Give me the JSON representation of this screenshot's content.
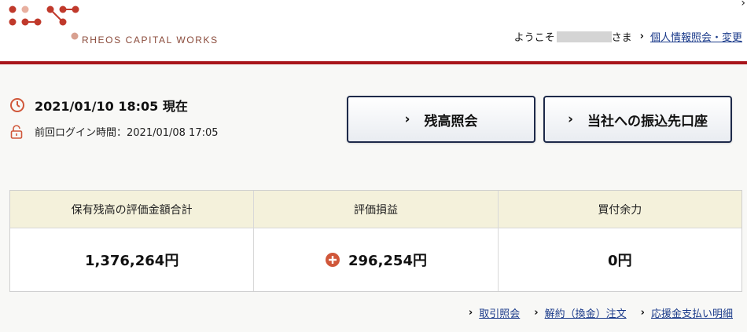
{
  "header": {
    "logo_text": "RHEOS CAPITAL WORKS",
    "welcome_prefix": "ようこそ",
    "welcome_suffix": "さま",
    "profile_link": "個人情報照会・変更",
    "brand_color": "#a8141a",
    "logo_dot_color": "#c0392b"
  },
  "status": {
    "now_text": "2021/01/10 18:05 現在",
    "last_login": "前回ログイン時間：2021/01/08 17:05"
  },
  "buttons": {
    "balance": "残高照会",
    "transfer": "当社への振込先口座",
    "chevron": "›"
  },
  "summary": {
    "headers": [
      "保有残高の評価金額合計",
      "評価損益",
      "買付余力"
    ],
    "values": [
      "1,376,264円",
      "296,254円",
      "0円"
    ]
  },
  "links": {
    "trade_history": "取引照会",
    "cancel_order": "解約（換金）注文",
    "support_payout": "応援金支払い明細"
  }
}
